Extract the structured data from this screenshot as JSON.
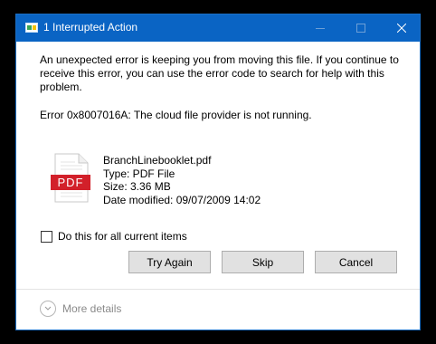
{
  "window": {
    "title": "1 Interrupted Action",
    "controls": {
      "minimize_icon": "minimize-icon",
      "maximize_icon": "maximize-icon",
      "close_icon": "close-icon"
    }
  },
  "dialog": {
    "message": "An unexpected error is keeping you from moving this file. If you continue to receive this error, you can use the error code to search for help with this problem.",
    "error": "Error 0x8007016A: The cloud file provider is not running."
  },
  "file": {
    "icon": "pdf-file-icon",
    "icon_label": "PDF",
    "name": "BranchLinebooklet.pdf",
    "type": "Type: PDF File",
    "size": "Size: 3.36 MB",
    "modified": "Date modified: 09/07/2009 14:02"
  },
  "options": {
    "apply_all_label": "Do this for all current items",
    "apply_all_checked": false
  },
  "buttons": {
    "try_again": "Try Again",
    "skip": "Skip",
    "cancel": "Cancel"
  },
  "footer": {
    "more_details": "More details"
  },
  "colors": {
    "titlebar": "#0a64c4",
    "pdf_red": "#d2202a"
  }
}
